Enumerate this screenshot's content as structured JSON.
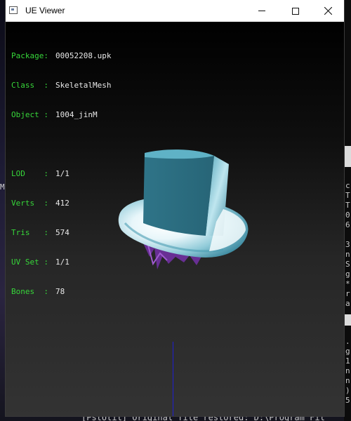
{
  "window": {
    "title": "UE Viewer"
  },
  "info": {
    "package": {
      "key": "Package:",
      "value": "00052208.upk"
    },
    "class": {
      "key": "Class  :",
      "value": "SkeletalMesh"
    },
    "object": {
      "key": "Object :",
      "value": "1004_jinM"
    },
    "lod": {
      "key": "LOD    :",
      "value": "1/1"
    },
    "verts": {
      "key": "Verts  :",
      "value": "412"
    },
    "tris": {
      "key": "Tris   :",
      "value": "574"
    },
    "uvset": {
      "key": "UV Set :",
      "value": "1/1"
    },
    "bones": {
      "key": "Bones  :",
      "value": "78"
    }
  },
  "console": {
    "right_lines": [
      "c",
      "T",
      "T",
      "0",
      "6",
      "",
      "3",
      "n",
      "S",
      "g",
      "*",
      "r",
      "a",
      "",
      ".",
      "g",
      "1",
      "n",
      "n",
      ")",
      "5"
    ],
    "bottom_line": "[PstUtil] Original file restored: D:\\Program Fil"
  },
  "desktop": {
    "left_glyph": "M"
  },
  "colors": {
    "info_key": "#37d63a",
    "info_value": "#e8e8e8",
    "axis": "#1f1fd0",
    "hat": "#2b6a80"
  },
  "icons": {
    "app": "ue-viewer-app-icon",
    "minimize": "minimize-icon",
    "maximize": "maximize-icon",
    "close": "close-icon"
  }
}
